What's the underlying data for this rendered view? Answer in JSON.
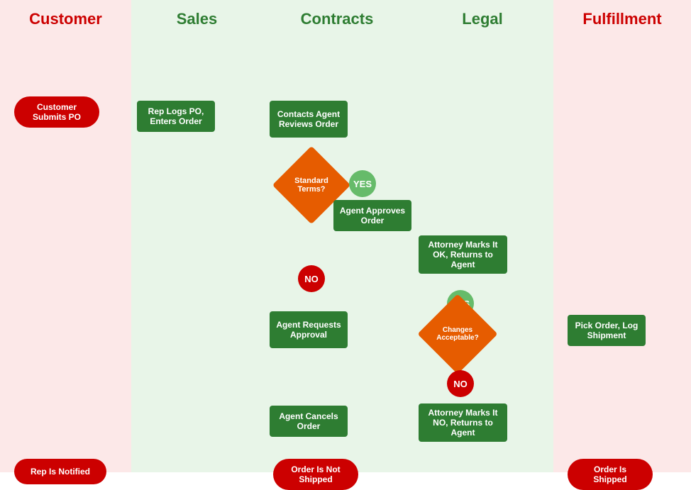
{
  "lanes": [
    {
      "id": "customer",
      "label": "Customer",
      "labelColor": "#cc0000",
      "bgColor": "#fce8e8"
    },
    {
      "id": "sales",
      "label": "Sales",
      "labelColor": "#2e7d32",
      "bgColor": "#e8f5e8"
    },
    {
      "id": "contracts",
      "label": "Contracts",
      "labelColor": "#2e7d32",
      "bgColor": "#e8f5e8"
    },
    {
      "id": "legal",
      "label": "Legal",
      "labelColor": "#2e7d32",
      "bgColor": "#e8f5e8"
    },
    {
      "id": "fulfillment",
      "label": "Fulfillment",
      "labelColor": "#cc0000",
      "bgColor": "#fce8e8"
    }
  ],
  "nodes": {
    "customer_submits": "Customer Submits PO",
    "rep_logs": "Rep Logs PO, Enters Order",
    "contacts_agent": "Contacts Agent Reviews Order",
    "standard_terms": "Standard Terms?",
    "agent_approves": "Agent Approves Order",
    "attorney_marks_ok": "Attorney Marks It OK, Returns to Agent",
    "changes_acceptable": "Changes Acceptable?",
    "no_label1": "NO",
    "yes_label1": "YES",
    "yes_label2": "YES",
    "no_label2": "NO",
    "agent_requests": "Agent Requests Approval",
    "agent_cancels": "Agent Cancels Order",
    "attorney_marks_no": "Attorney Marks It NO, Returns to Agent",
    "rep_notified": "Rep Is Notified",
    "order_not_shipped": "Order Is Not Shipped",
    "pick_order": "Pick Order, Log Shipment",
    "order_shipped": "Order Is Shipped"
  }
}
